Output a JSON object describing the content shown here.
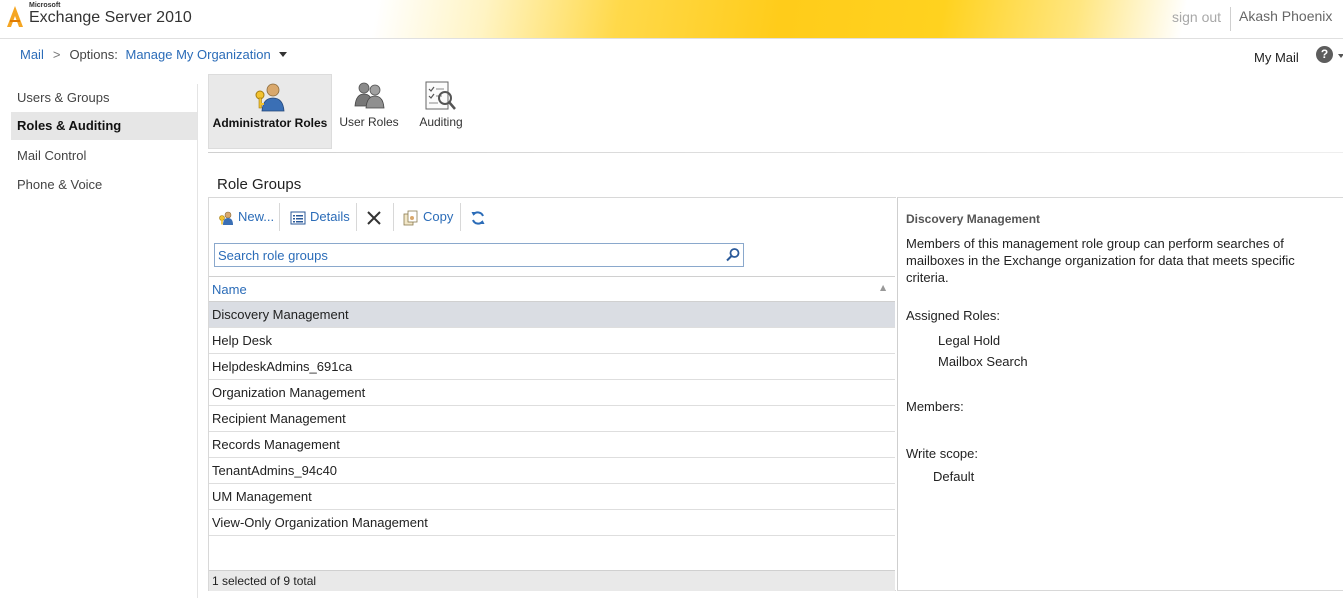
{
  "header": {
    "ms_label": "Microsoft",
    "product": "Exchange Server 2010",
    "signout": "sign out",
    "user": "Akash Phoenix"
  },
  "breadcrumb": {
    "mail": "Mail",
    "options_label": "Options:",
    "scope": "Manage My Organization"
  },
  "topright": {
    "mymail": "My Mail",
    "help": "?"
  },
  "nav": {
    "items": [
      {
        "label": "Users & Groups"
      },
      {
        "label": "Roles & Auditing"
      },
      {
        "label": "Mail Control"
      },
      {
        "label": "Phone & Voice"
      }
    ],
    "active": "Roles & Auditing"
  },
  "tabs": [
    {
      "label": "Administrator Roles",
      "icon": "admin-roles-icon"
    },
    {
      "label": "User Roles",
      "icon": "user-roles-icon"
    },
    {
      "label": "Auditing",
      "icon": "auditing-icon"
    }
  ],
  "section_title": "Role Groups",
  "toolbar": {
    "new": "New...",
    "details": "Details",
    "delete_icon": "delete-x-icon",
    "copy": "Copy",
    "refresh_icon": "refresh-icon"
  },
  "search": {
    "placeholder": "Search role groups"
  },
  "grid": {
    "column": "Name",
    "rows": [
      "Discovery Management",
      "Help Desk",
      "HelpdeskAdmins_691ca",
      "Organization Management",
      "Recipient Management",
      "Records Management",
      "TenantAdmins_94c40",
      "UM Management",
      "View-Only Organization Management"
    ],
    "selected": "Discovery Management",
    "status": "1 selected of 9 total"
  },
  "detail": {
    "title": "Discovery Management",
    "description": "Members of this management role group can perform searches of mailboxes in the Exchange organization for data that meets specific criteria.",
    "assigned_roles_label": "Assigned Roles:",
    "assigned_roles": [
      "Legal Hold",
      "Mailbox Search"
    ],
    "members_label": "Members:",
    "write_scope_label": "Write scope:",
    "write_scope": "Default"
  },
  "colors": {
    "link": "#2b6cb8",
    "selected_row": "#dadde3",
    "header_yellow": "#ffcc1a"
  }
}
